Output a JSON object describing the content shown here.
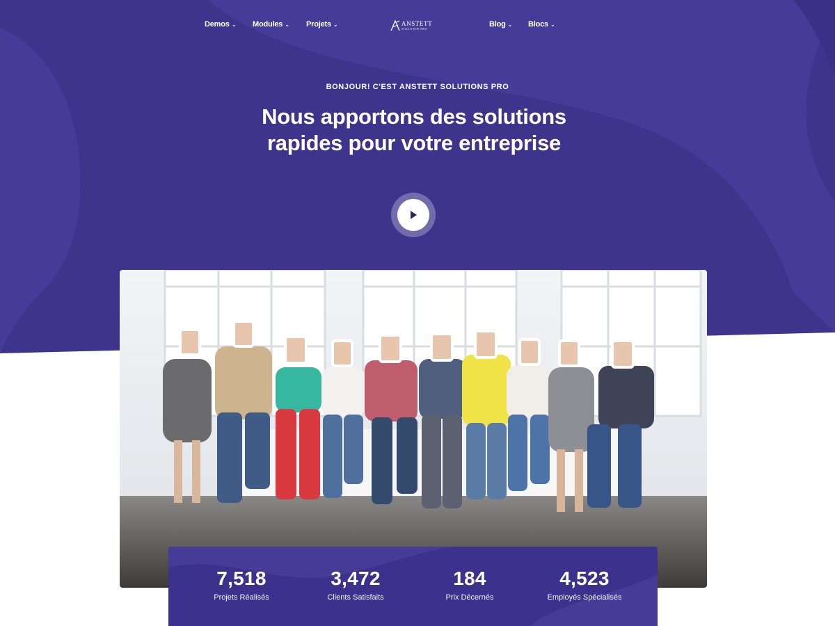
{
  "colors": {
    "brand": "#3e348c",
    "brand_blob": "#463c98",
    "text_on_brand": "#ffffff",
    "page_bg": "#ffffff"
  },
  "nav": {
    "left": [
      {
        "label": "Demos",
        "icon": "chevron-down-icon"
      },
      {
        "label": "Modules",
        "icon": "chevron-down-icon"
      },
      {
        "label": "Projets",
        "icon": "chevron-down-icon"
      }
    ],
    "right": [
      {
        "label": "Blog",
        "icon": "chevron-down-icon"
      },
      {
        "label": "Blocs",
        "icon": "chevron-down-icon"
      }
    ],
    "chevron": "⌄"
  },
  "logo": {
    "title": "ANSTETT",
    "subtitle": "SOLUTION PRO"
  },
  "hero": {
    "eyebrow": "BONJOUR! C'EST ANSTETT SOLUTIONS PRO",
    "headline": "Nous apportons des solutions rapides pour votre entreprise",
    "play_icon": "play-icon"
  },
  "stats": [
    {
      "value": "7,518",
      "label": "Projets Réalisés"
    },
    {
      "value": "3,472",
      "label": "Clients Satisfaits"
    },
    {
      "value": "184",
      "label": "Prix Décernés"
    },
    {
      "value": "4,523",
      "label": "Employés Spécialisés"
    }
  ]
}
